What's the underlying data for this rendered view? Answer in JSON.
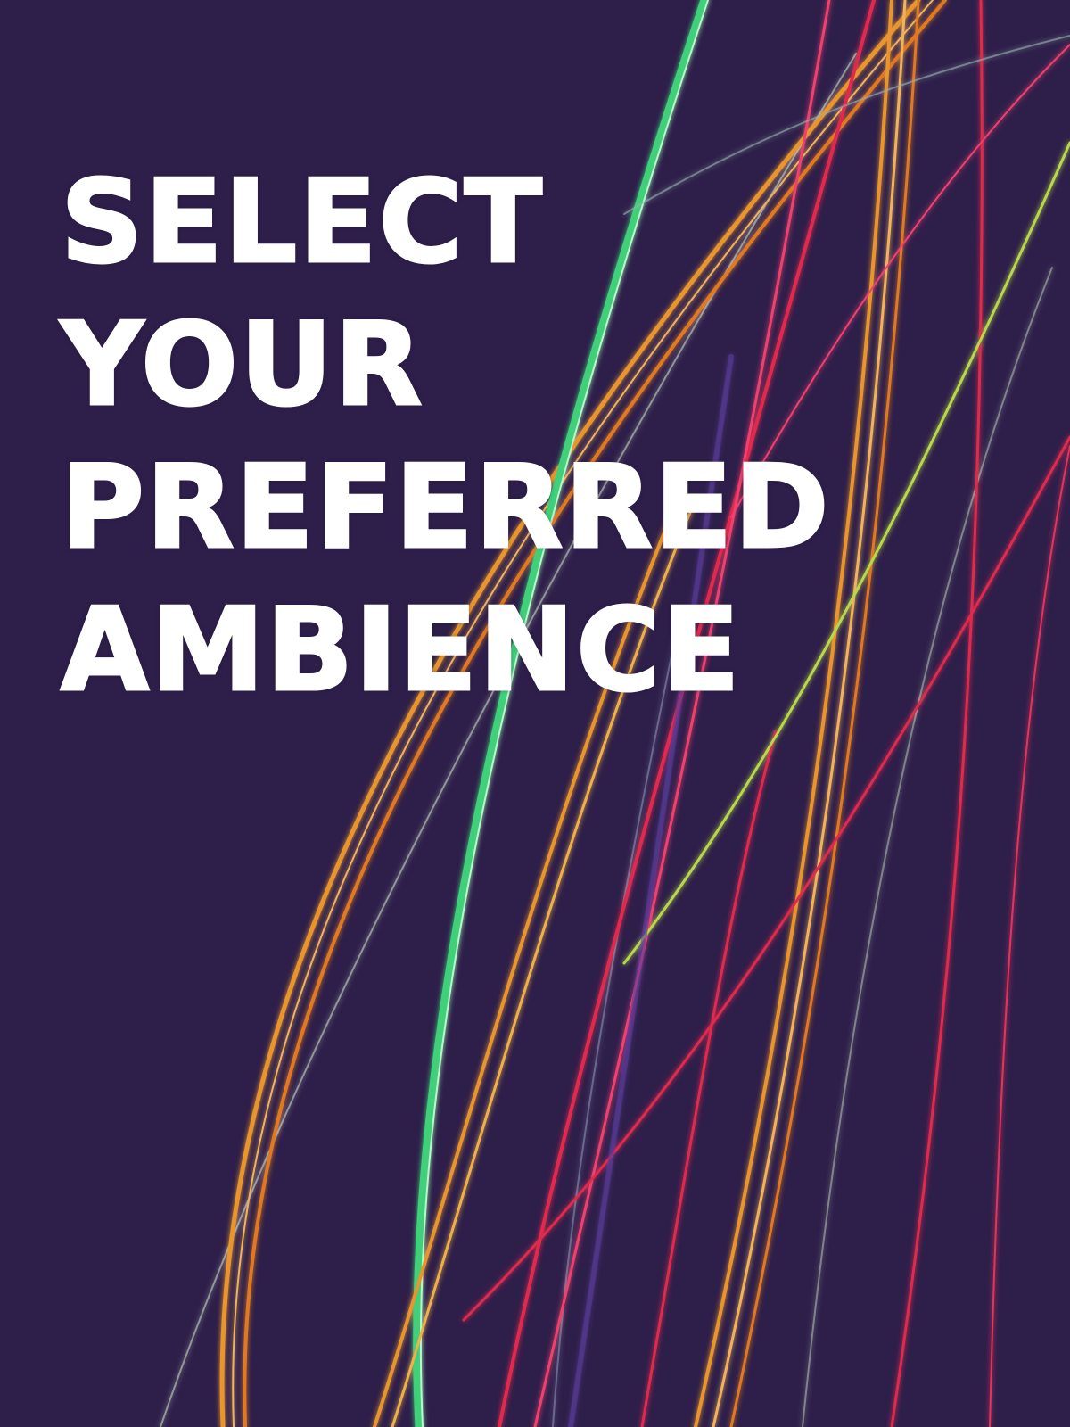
{
  "headline": {
    "lines": [
      "SELECT",
      "YOUR",
      "PREFERRED",
      "AMBIENCE"
    ]
  },
  "colors": {
    "background": "#2e1f4a",
    "text": "#ffffff",
    "trail_orange": "#e8952e",
    "trail_green": "#3fd07a",
    "trail_red": "#e02a4e",
    "trail_pink": "#f0406e",
    "trail_yellow_green": "#b9d84a",
    "trail_pale": "#d8e7d0"
  }
}
